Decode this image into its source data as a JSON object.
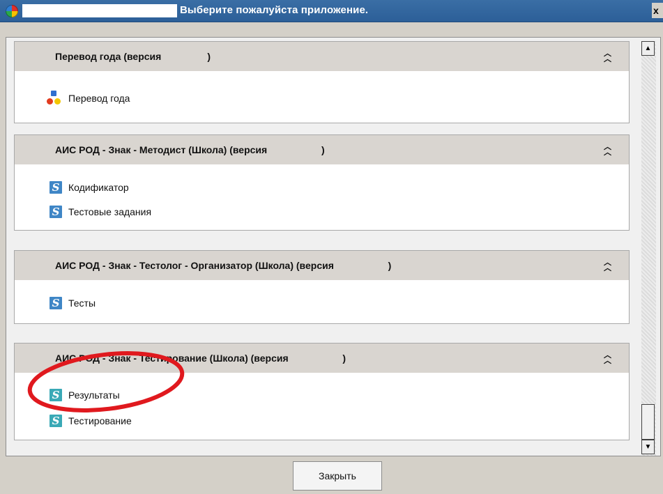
{
  "window": {
    "title": "Выберите пожалуйста приложение.",
    "close_glyph": "x"
  },
  "panels": [
    {
      "title": "Перевод года (версия                 )",
      "items": [
        {
          "label": "Перевод года",
          "icon": "transfer-icon"
        }
      ]
    },
    {
      "title": "АИС РОД - Знак - Методист (Школа) (версия                    )",
      "items": [
        {
          "label": "Кодификатор",
          "icon": "znak-app-icon"
        },
        {
          "label": "Тестовые задания",
          "icon": "znak-app-icon"
        }
      ]
    },
    {
      "title": "АИС РОД - Знак - Тестолог - Организатор (Школа) (версия                    )",
      "items": [
        {
          "label": "Тесты",
          "icon": "znak-app-icon"
        }
      ]
    },
    {
      "title": "АИС РОД - Знак - Тестирование (Школа) (версия                    )",
      "items": [
        {
          "label": "Результаты",
          "icon": "znak-app-icon"
        },
        {
          "label": "Тестирование",
          "icon": "znak-app-icon"
        }
      ]
    }
  ],
  "icons": {
    "collapse": "double-chevron-up-icon",
    "app_glyph": "S"
  },
  "footer": {
    "close_label": "Закрыть"
  },
  "colors": {
    "titlebar": "#2c5f98",
    "annotation": "#e0191e",
    "icon_blue": "#3f86c6",
    "icon_teal": "#3aa9b6"
  }
}
